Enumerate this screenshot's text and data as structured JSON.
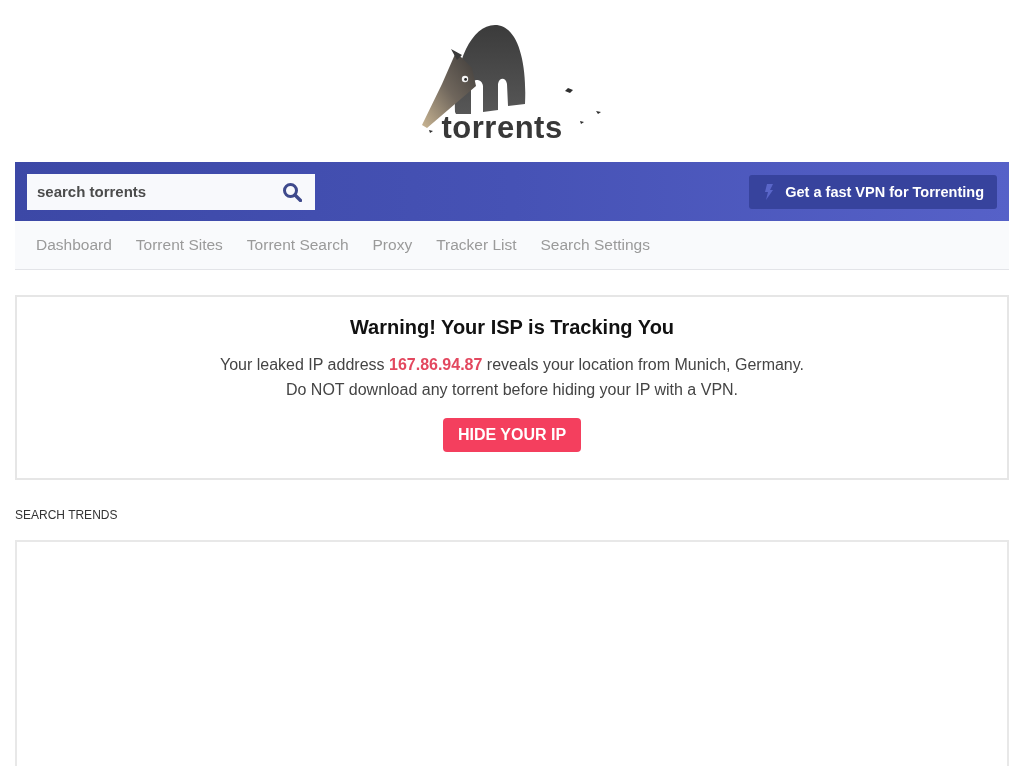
{
  "logo": {
    "wordmark": "torrents"
  },
  "header": {
    "search": {
      "placeholder": "search torrents"
    },
    "vpn_button": "Get a fast VPN for Torrenting"
  },
  "nav": {
    "items": [
      "Dashboard",
      "Torrent Sites",
      "Torrent Search",
      "Proxy",
      "Tracker List",
      "Search Settings"
    ]
  },
  "warning": {
    "title": "Warning! Your ISP is Tracking You",
    "lines": [
      "Your leaked IP address **167.86.94.87** reveals your location from Munich, Germany.",
      "Do NOT download any torrent before hiding your IP with a VPN."
    ],
    "button": "HIDE YOUR IP"
  },
  "search_trends": {
    "heading": "SEARCH TRENDS"
  }
}
